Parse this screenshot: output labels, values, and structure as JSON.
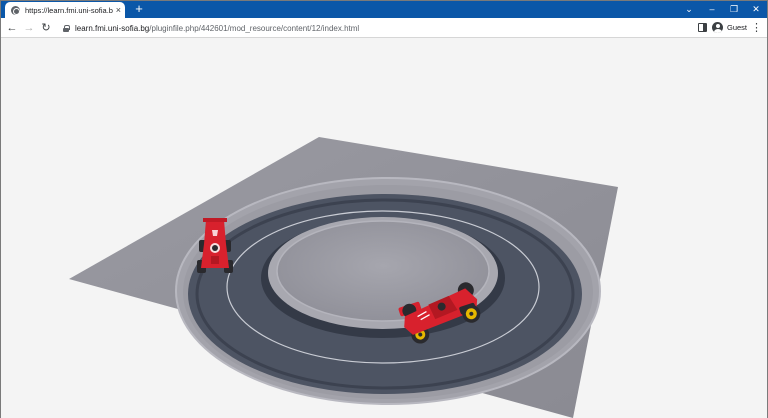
{
  "browser": {
    "tab": {
      "title": "https://learn.fmi.uni-sofia.bg/pl...",
      "favicon": "globe-icon",
      "close": "×"
    },
    "new_tab": "+",
    "window_controls": {
      "dropdown": "⌄",
      "minimize": "–",
      "restore": "❐",
      "close": "✕"
    },
    "nav": {
      "back": "←",
      "forward": "→",
      "reload": "↻"
    },
    "address": {
      "host": "learn.fmi.uni-sofia.bg",
      "path": "/pluginfile.php/442601/mod_resource/content/12/index.html"
    },
    "profile": {
      "label": "Guest",
      "icon": "person-circle-icon"
    },
    "menu": "⋮"
  },
  "colors": {
    "tabbar": "#0b57a8",
    "page_bg": "#f4f4f4",
    "ground": "#8e8e96",
    "track": "#4d5463",
    "car_body": "#d8212d",
    "wheel_rim": "#e6b800"
  },
  "scene": {
    "description_icons": [
      "ground-plane",
      "race-track",
      "race-car-left",
      "race-car-right"
    ]
  }
}
